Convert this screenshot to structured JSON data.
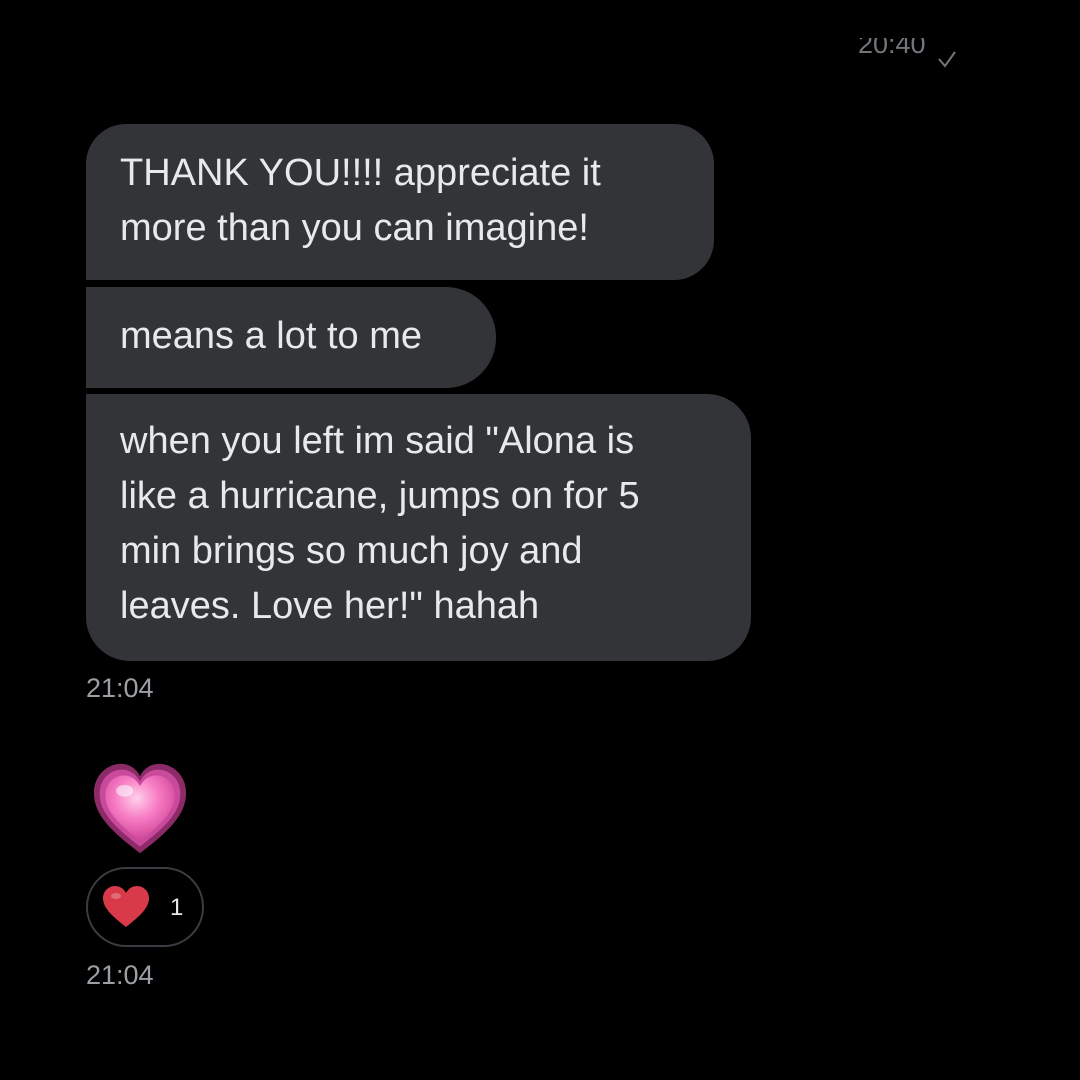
{
  "header": {
    "last_timestamp": "20:40"
  },
  "messages": [
    {
      "text": "THANK YOU!!!! appreciate it\nmore than you can imagine!"
    },
    {
      "text": "means a lot to me"
    },
    {
      "text": "when you left im said \"Alona is\nlike a hurricane, jumps on for 5\nmin brings so much joy and\nleaves. Love her!\" hahah"
    }
  ],
  "group_1": {
    "timestamp": "21:04"
  },
  "emoji_message": {
    "icon": "growing-heart-icon"
  },
  "reaction": {
    "icon": "red-heart-icon",
    "count": "1"
  },
  "group_2": {
    "timestamp": "21:04"
  },
  "colors": {
    "background": "#000000",
    "bubble": "#333437",
    "text": "#e7e9ea",
    "muted": "#71767b",
    "heart_pink": "#f06fb9",
    "heart_red": "#d93a4a"
  }
}
